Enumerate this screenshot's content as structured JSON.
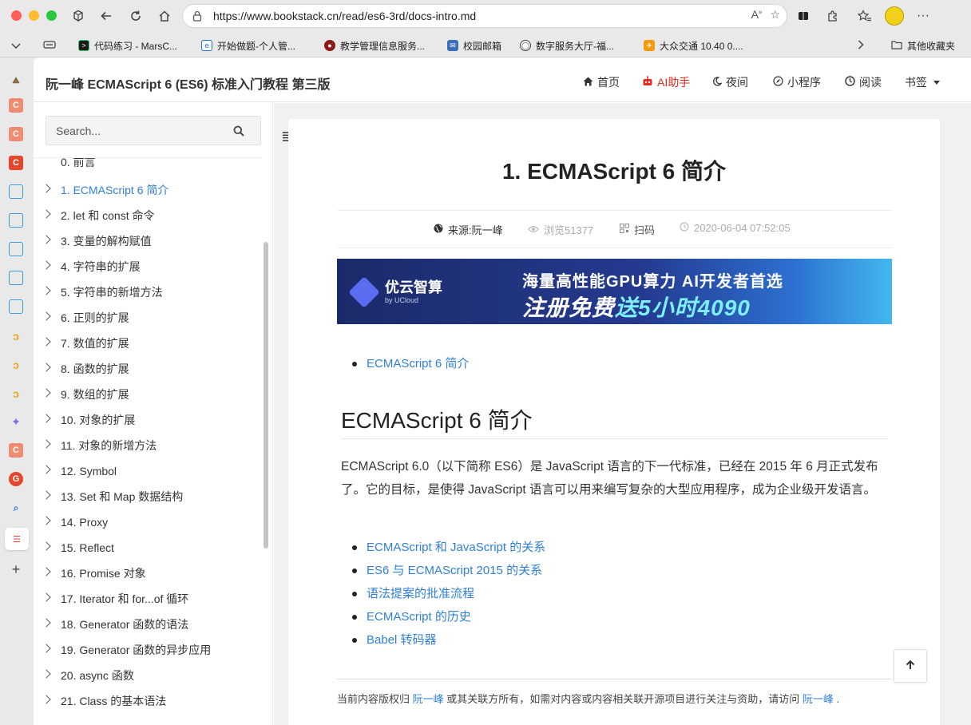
{
  "browser": {
    "url": "https://www.bookstack.cn/read/es6-3rd/docs-intro.md",
    "bookmarks": [
      {
        "label": "代码练习 - MarsC...",
        "color": "#1a1a1a"
      },
      {
        "label": "开始做题-个人管...",
        "color": "#1e6fd0"
      },
      {
        "label": "教学管理信息服务...",
        "color": "#8a1b1b"
      },
      {
        "label": "校园邮箱",
        "color": "#3a6fb8"
      },
      {
        "label": "数字服务大厅-福...",
        "color": "#444444"
      },
      {
        "label": "大众交通 10.40 0....",
        "color": "#f39c12"
      }
    ],
    "other_bookmarks": "其他收藏夹"
  },
  "site": {
    "title": "阮一峰 ECMAScript 6 (ES6) 标准入门教程 第三版",
    "nav": {
      "home": "首页",
      "ai": "AI助手",
      "night": "夜间",
      "miniprogram": "小程序",
      "read": "阅读",
      "bookmark": "书签"
    }
  },
  "sidebar": {
    "search_placeholder": "Search...",
    "items": [
      {
        "label": "0. 前言",
        "active": false
      },
      {
        "label": "1. ECMAScript 6 简介",
        "active": true
      },
      {
        "label": "2. let 和 const 命令",
        "active": false
      },
      {
        "label": "3. 变量的解构赋值",
        "active": false
      },
      {
        "label": "4. 字符串的扩展",
        "active": false
      },
      {
        "label": "5. 字符串的新增方法",
        "active": false
      },
      {
        "label": "6. 正则的扩展",
        "active": false
      },
      {
        "label": "7. 数值的扩展",
        "active": false
      },
      {
        "label": "8. 函数的扩展",
        "active": false
      },
      {
        "label": "9. 数组的扩展",
        "active": false
      },
      {
        "label": "10. 对象的扩展",
        "active": false
      },
      {
        "label": "11. 对象的新增方法",
        "active": false
      },
      {
        "label": "12. Symbol",
        "active": false
      },
      {
        "label": "13. Set 和 Map 数据结构",
        "active": false
      },
      {
        "label": "14. Proxy",
        "active": false
      },
      {
        "label": "15. Reflect",
        "active": false
      },
      {
        "label": "16. Promise 对象",
        "active": false
      },
      {
        "label": "17. Iterator 和 for...of 循环",
        "active": false
      },
      {
        "label": "18. Generator 函数的语法",
        "active": false
      },
      {
        "label": "19. Generator 函数的异步应用",
        "active": false
      },
      {
        "label": "20. async 函数",
        "active": false
      },
      {
        "label": "21. Class 的基本语法",
        "active": false
      }
    ]
  },
  "article": {
    "title": "1. ECMAScript 6 简介",
    "meta": {
      "source": "来源:阮一峰",
      "views": "浏览51377",
      "scan": "扫码",
      "date": "2020-06-04 07:52:05"
    },
    "banner": {
      "brand": "优云智算",
      "brand_sub": "by UCloud",
      "line1": "海量高性能GPU算力 AI开发者首选",
      "line2_a": "注册免费",
      "line2_b": "送5小时4090"
    },
    "toc_link": "ECMAScript 6 简介",
    "heading": "ECMAScript 6 简介",
    "paragraph": "ECMAScript 6.0（以下简称 ES6）是 JavaScript 语言的下一代标准，已经在 2015 年 6 月正式发布了。它的目标，是使得 JavaScript 语言可以用来编写复杂的大型应用程序，成为企业级开发语言。",
    "links": [
      "ECMAScript 和 JavaScript 的关系",
      "ES6 与 ECMAScript 2015 的关系",
      "语法提案的批准流程",
      "ECMAScript 的历史",
      "Babel 转码器"
    ],
    "footer": {
      "prefix": "当前内容版权归",
      "author1": "阮一峰",
      "middle": "或其关联方所有，如需对内容或内容相关联开源项目进行关注与资助，请访问",
      "author2": "阮一峰",
      "suffix": "."
    }
  }
}
